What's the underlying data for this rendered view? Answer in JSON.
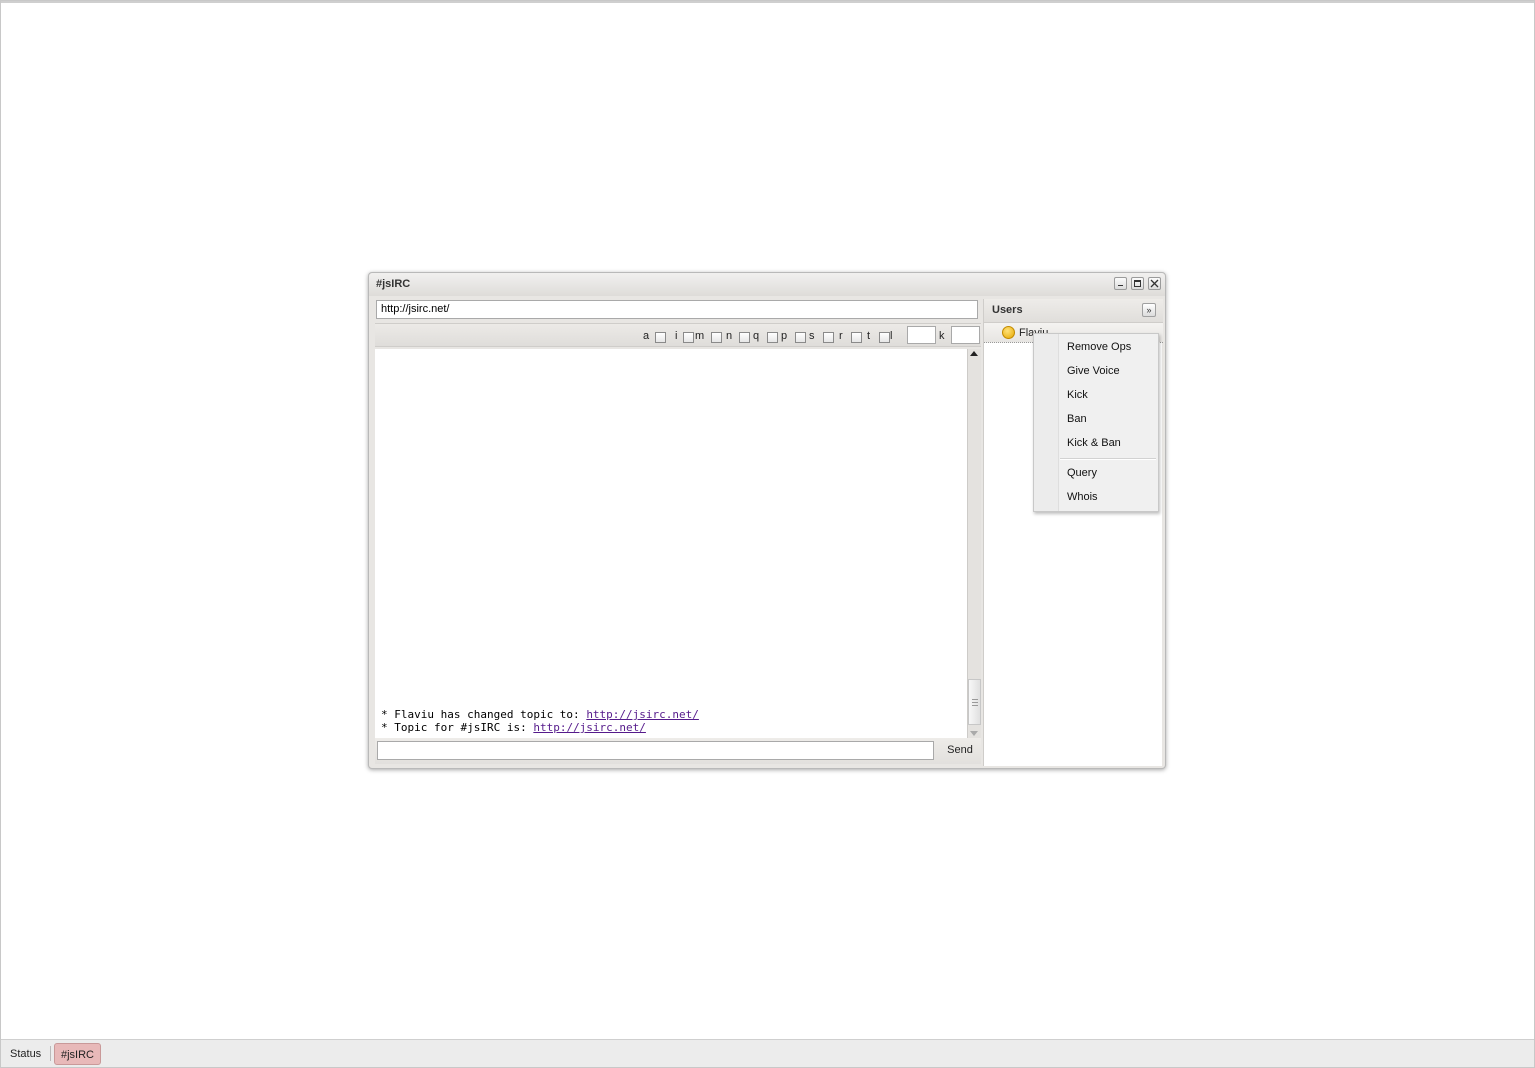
{
  "window": {
    "title": "#jsIRC"
  },
  "topic": {
    "value": "http://jsirc.net/"
  },
  "modes": {
    "flags": [
      "a",
      "i",
      "m",
      "n",
      "q",
      "p",
      "s",
      "r",
      "t",
      "l"
    ],
    "key_label": "k"
  },
  "log": {
    "lines": [
      {
        "prefix": "* Flaviu has changed topic to: ",
        "link": "http://jsirc.net/"
      },
      {
        "prefix": "* Topic for #jsIRC is: ",
        "link": "http://jsirc.net/"
      }
    ]
  },
  "input": {
    "send_label": "Send"
  },
  "users": {
    "title": "Users",
    "collapse_glyph": "»",
    "list": [
      {
        "name": "Flaviu",
        "icon": "op-icon"
      }
    ]
  },
  "context_menu": {
    "items": [
      "Remove Ops",
      "Give Voice",
      "Kick",
      "Ban",
      "Kick & Ban"
    ],
    "items2": [
      "Query",
      "Whois"
    ]
  },
  "taskbar": {
    "items": [
      "Status",
      "#jsIRC"
    ],
    "active_color": "#e8b9b9"
  }
}
